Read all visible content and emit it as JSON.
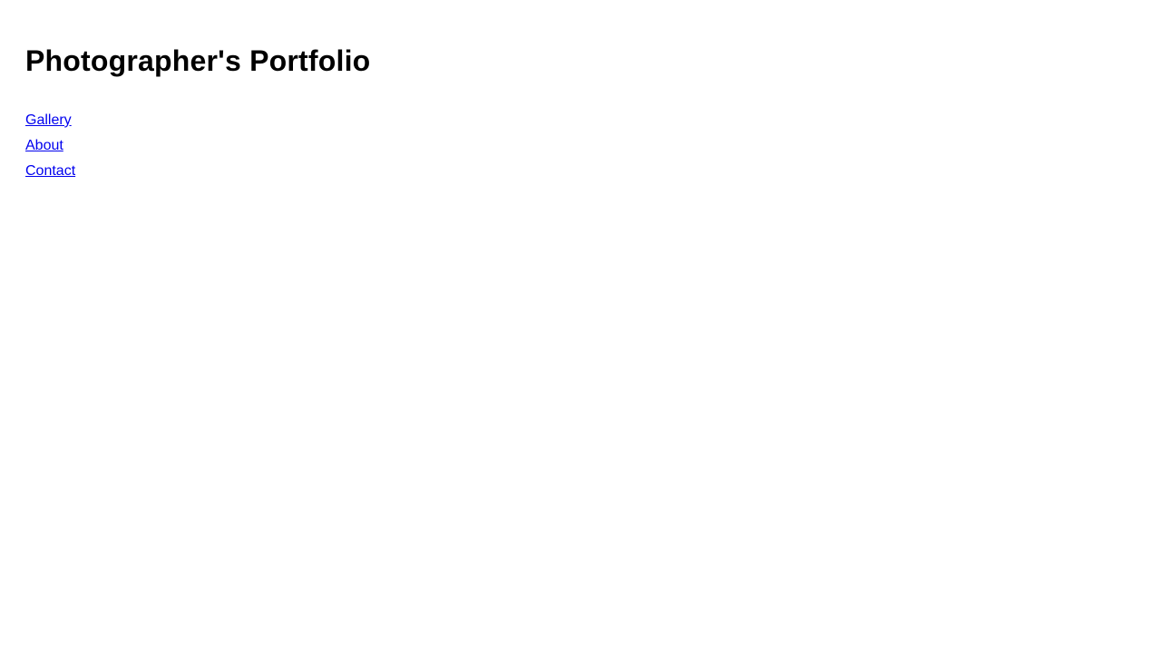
{
  "header": {
    "title": "Photographer's Portfolio"
  },
  "nav": {
    "items": [
      {
        "label": "Gallery"
      },
      {
        "label": "About"
      },
      {
        "label": "Contact"
      }
    ]
  },
  "colors": {
    "link": "#0000ee",
    "text": "#000000",
    "background": "#ffffff"
  }
}
